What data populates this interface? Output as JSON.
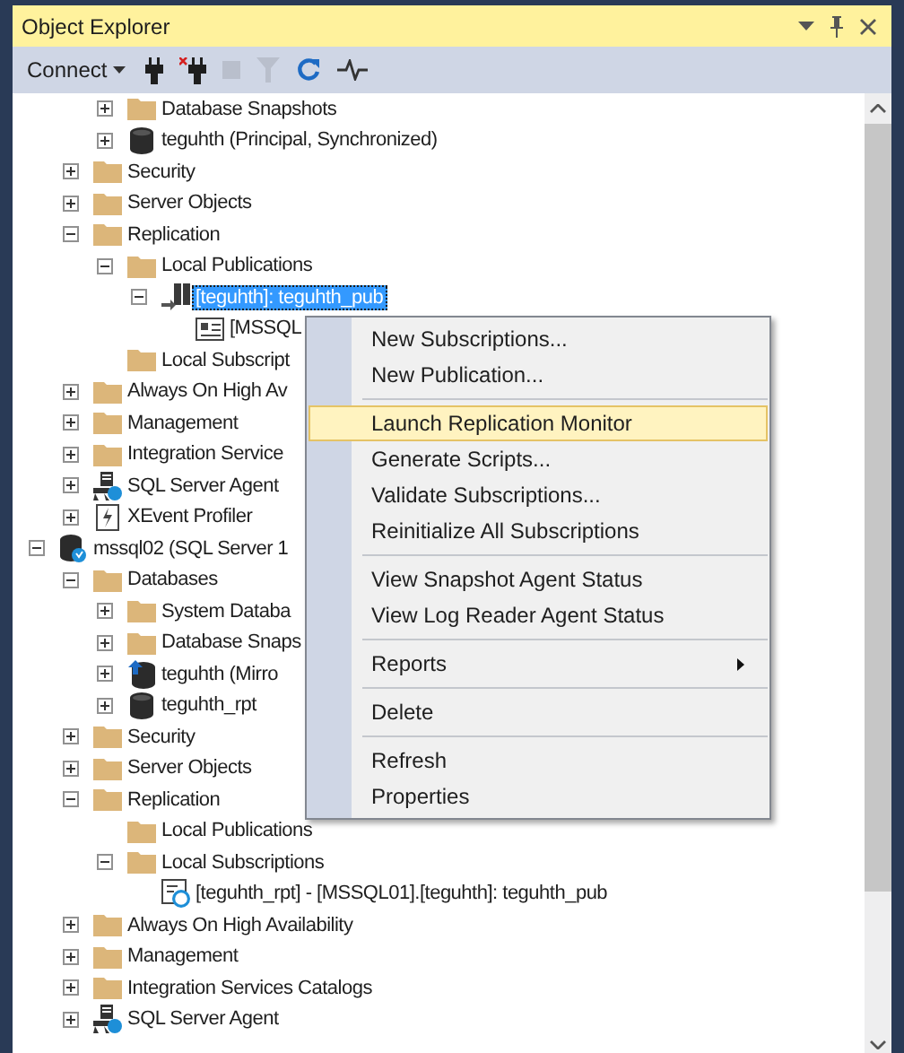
{
  "panel": {
    "title": "Object Explorer"
  },
  "toolbar": [
    {
      "kind": "connect",
      "label": "Connect",
      "disabled": false
    },
    {
      "kind": "plug",
      "disabled": false
    },
    {
      "kind": "unplug",
      "disabled": false
    },
    {
      "kind": "stop",
      "disabled": true
    },
    {
      "kind": "filter",
      "disabled": true
    },
    {
      "kind": "refresh",
      "disabled": false
    },
    {
      "kind": "activity",
      "disabled": false
    }
  ],
  "tree": [
    {
      "children": [
        {
          "children": [
            {
              "label": "Database Snapshots",
              "kind": "folder",
              "expanded": false,
              "selected": false
            },
            {
              "label": "teguhth (Principal, Synchronized)",
              "kind": "database",
              "expanded": false,
              "selected": false
            }
          ]
        },
        {
          "label": "Security",
          "kind": "folder",
          "expanded": false,
          "selected": false
        },
        {
          "label": "Server Objects",
          "kind": "folder",
          "expanded": false,
          "selected": false
        },
        {
          "label": "Replication",
          "kind": "folder",
          "expanded": true,
          "selected": false,
          "children": [
            {
              "label": "Local Publications",
              "kind": "folder",
              "expanded": true,
              "selected": false,
              "children": [
                {
                  "label": "[teguhth]: teguhth_pub",
                  "kind": "publication",
                  "expanded": true,
                  "selected": true,
                  "children": [
                    {
                      "label": "[MSSQL",
                      "kind": "subscriber",
                      "selected": false
                    }
                  ]
                }
              ]
            },
            {
              "label": "Local Subscript",
              "kind": "folder",
              "selected": false
            }
          ]
        },
        {
          "label": "Always On High Av",
          "kind": "folder",
          "expanded": false,
          "selected": false
        },
        {
          "label": "Management",
          "kind": "folder",
          "expanded": false,
          "selected": false
        },
        {
          "label": "Integration Service",
          "kind": "folder",
          "expanded": false,
          "selected": false
        },
        {
          "label": "SQL Server Agent",
          "kind": "agent",
          "expanded": false,
          "selected": false
        },
        {
          "label": "XEvent Profiler",
          "kind": "xevent",
          "expanded": false,
          "selected": false
        }
      ]
    },
    {
      "label": "mssql02 (SQL Server 1",
      "kind": "server",
      "expanded": true,
      "selected": false,
      "children": [
        {
          "label": "Databases",
          "kind": "folder",
          "expanded": true,
          "selected": false,
          "children": [
            {
              "label": "System Databa",
              "kind": "folder",
              "expanded": false,
              "selected": false
            },
            {
              "label": "Database Snaps",
              "kind": "folder",
              "expanded": false,
              "selected": false
            },
            {
              "label": "teguhth (Mirro",
              "kind": "mirror",
              "expanded": false,
              "selected": false
            },
            {
              "label": "teguhth_rpt",
              "kind": "database",
              "expanded": false,
              "selected": false
            }
          ]
        },
        {
          "label": "Security",
          "kind": "folder",
          "expanded": false,
          "selected": false
        },
        {
          "label": "Server Objects",
          "kind": "folder",
          "expanded": false,
          "selected": false
        },
        {
          "label": "Replication",
          "kind": "folder",
          "expanded": true,
          "selected": false,
          "children": [
            {
              "label": "Local Publications",
              "kind": "folder",
              "selected": false
            },
            {
              "label": "Local Subscriptions",
              "kind": "folder",
              "expanded": true,
              "selected": false,
              "children": [
                {
                  "label": "[teguhth_rpt] - [MSSQL01].[teguhth]: teguhth_pub",
                  "kind": "subscription",
                  "selected": false
                }
              ]
            }
          ]
        },
        {
          "label": "Always On High Availability",
          "kind": "folder",
          "expanded": false,
          "selected": false
        },
        {
          "label": "Management",
          "kind": "folder",
          "expanded": false,
          "selected": false
        },
        {
          "label": "Integration Services Catalogs",
          "kind": "folder",
          "expanded": false,
          "selected": false
        },
        {
          "label": "SQL Server Agent",
          "kind": "agent",
          "expanded": false,
          "selected": false
        }
      ]
    }
  ],
  "context_menu": [
    {
      "kind": "item",
      "label": "New Subscriptions...",
      "selected": false
    },
    {
      "kind": "item",
      "label": "New Publication...",
      "selected": false
    },
    {
      "kind": "separator"
    },
    {
      "kind": "item",
      "label": "Launch Replication Monitor",
      "selected": true
    },
    {
      "kind": "item",
      "label": "Generate Scripts...",
      "selected": false
    },
    {
      "kind": "item",
      "label": "Validate Subscriptions...",
      "selected": false
    },
    {
      "kind": "item",
      "label": "Reinitialize All Subscriptions",
      "selected": false
    },
    {
      "kind": "separator"
    },
    {
      "kind": "item",
      "label": "View Snapshot Agent Status",
      "selected": false
    },
    {
      "kind": "item",
      "label": "View Log Reader Agent Status",
      "selected": false
    },
    {
      "kind": "separator"
    },
    {
      "kind": "submenu",
      "label": "Reports",
      "selected": false
    },
    {
      "kind": "separator"
    },
    {
      "kind": "item",
      "label": "Delete",
      "selected": false
    },
    {
      "kind": "separator"
    },
    {
      "kind": "item",
      "label": "Refresh",
      "selected": false
    },
    {
      "kind": "item",
      "label": "Properties",
      "selected": false
    }
  ]
}
